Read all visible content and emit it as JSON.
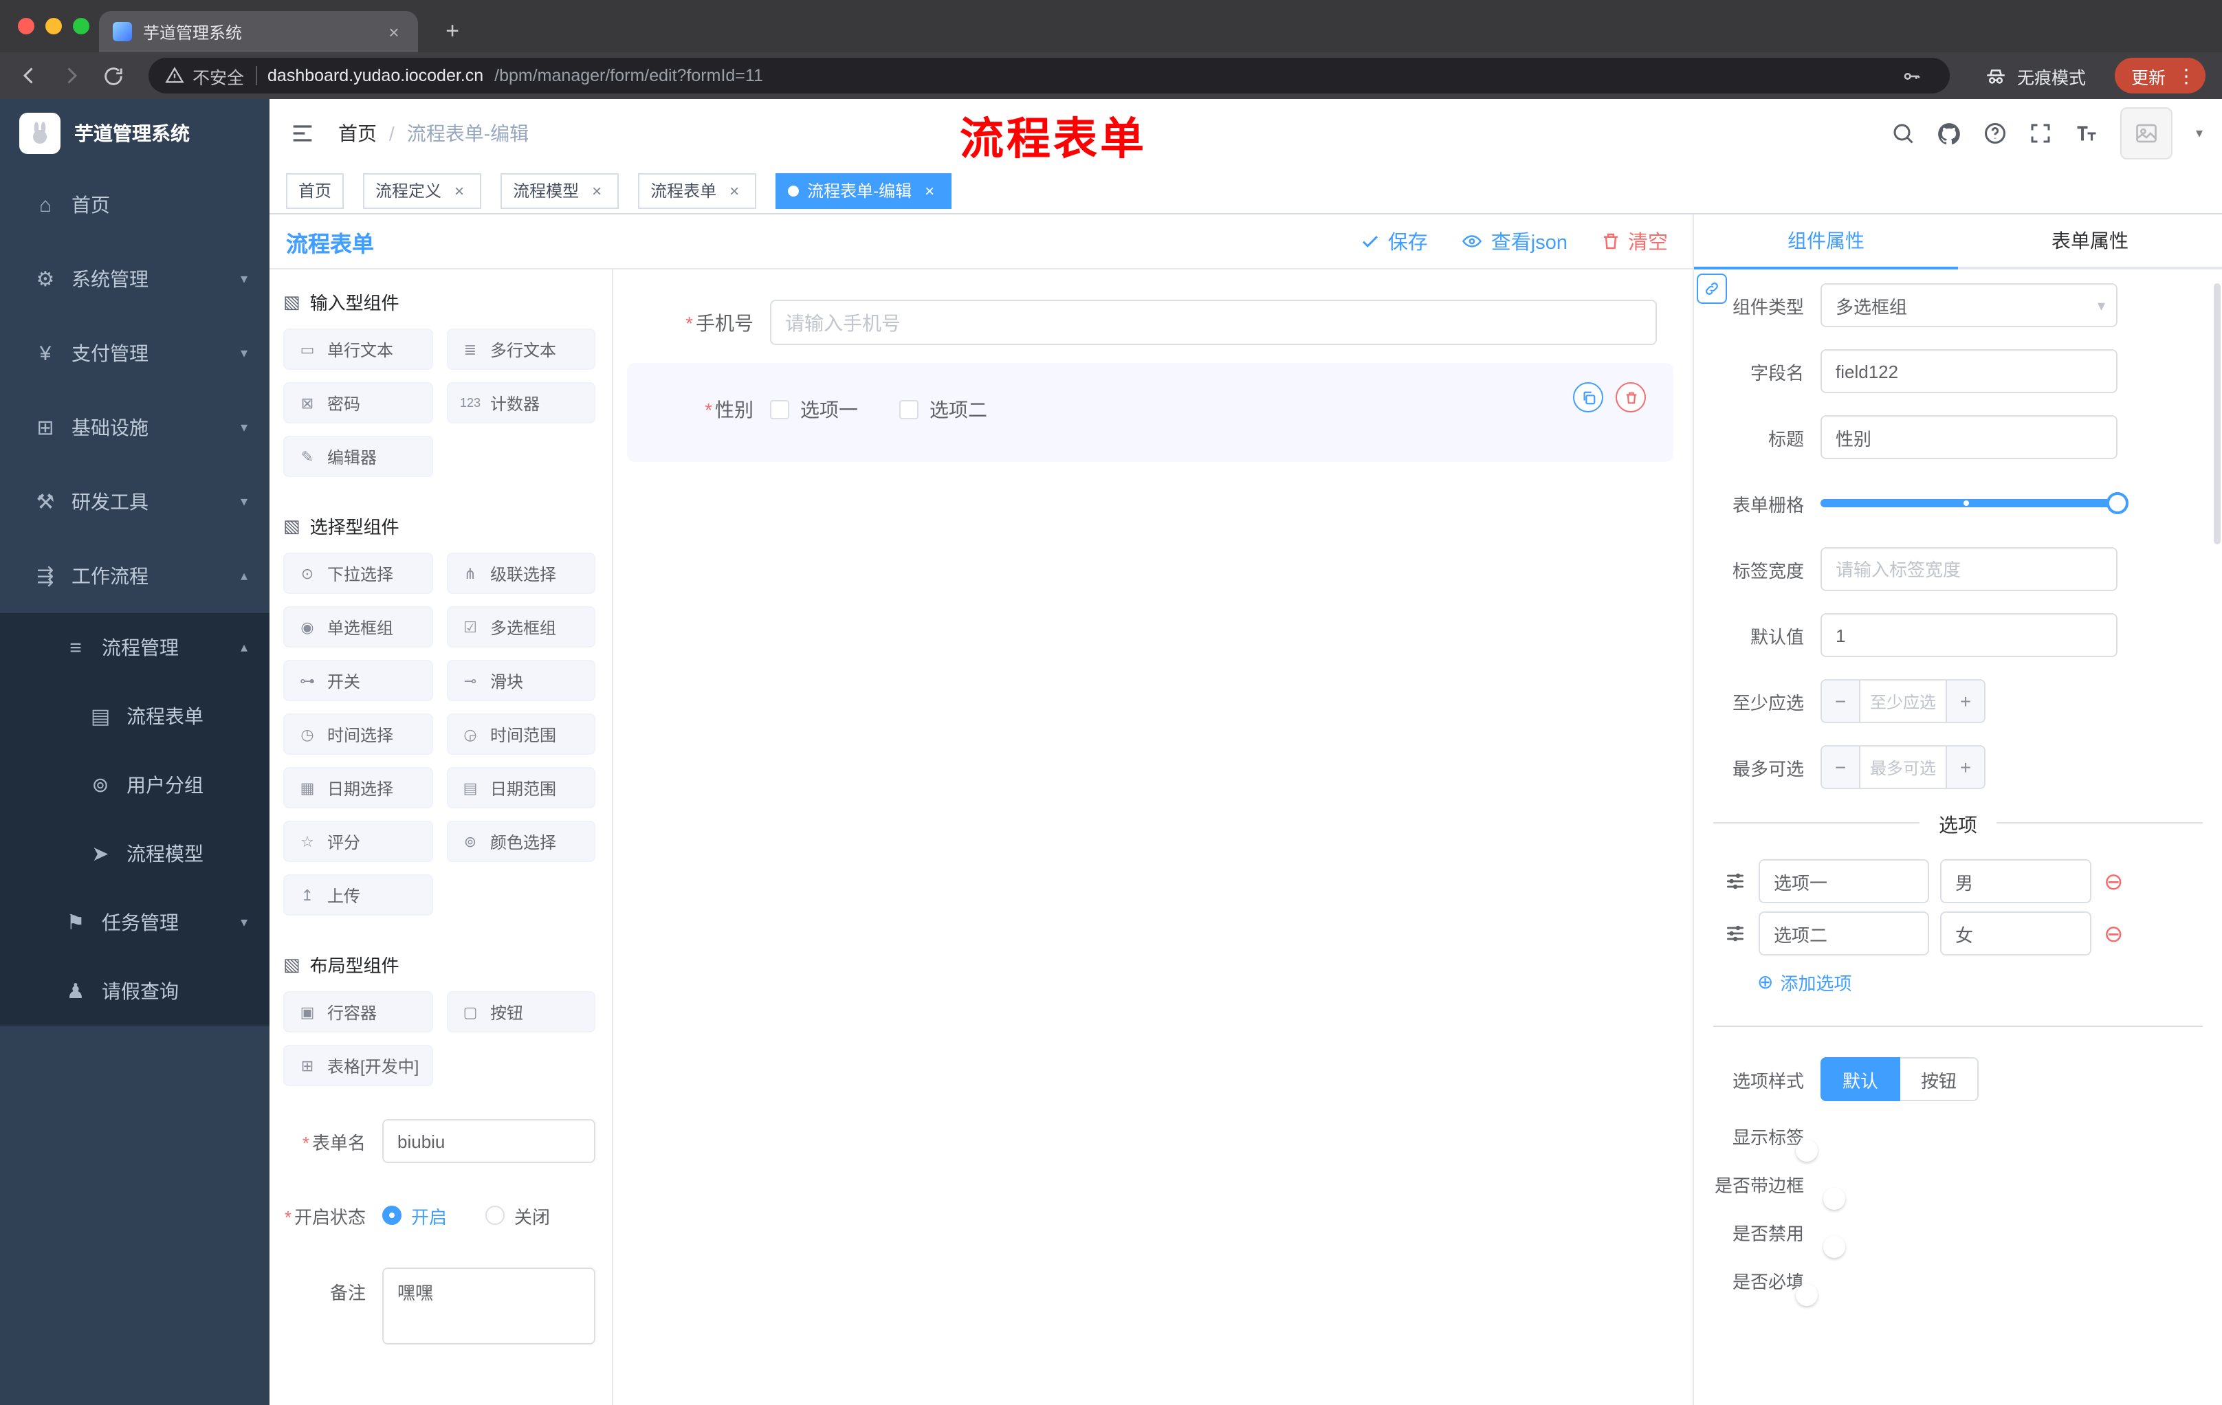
{
  "colors": {
    "accent": "#409eff",
    "danger": "#f56c6c",
    "annotation": "#ff0000",
    "sidebar_bg": "#304156",
    "sidebar_sub_bg": "#1f2d3d"
  },
  "icons": {
    "close": "×",
    "plus": "+",
    "kebab": "⋮",
    "caret_down": "▾",
    "required": "*",
    "minus": "−",
    "plus_sign": "+",
    "circle_plus": "⊕",
    "circle_minus": "⊖",
    "group": "▧"
  },
  "browser": {
    "tab_title": "芋道管理系统",
    "security_label": "不安全",
    "url_host": "dashboard.yudao.iocoder.cn",
    "url_path": "/bpm/manager/form/edit?formId=11",
    "incognito_label": "无痕模式",
    "update_label": "更新"
  },
  "annotation": {
    "text": "流程表单"
  },
  "sidebar": {
    "logo_title": "芋道管理系统",
    "items": [
      {
        "icon": "⌂",
        "label": "首页",
        "level": 1,
        "chevron": ""
      },
      {
        "icon": "⚙",
        "label": "系统管理",
        "level": 1,
        "chevron": "▾"
      },
      {
        "icon": "¥",
        "label": "支付管理",
        "level": 1,
        "chevron": "▾"
      },
      {
        "icon": "⊞",
        "label": "基础设施",
        "level": 1,
        "chevron": "▾"
      },
      {
        "icon": "⚒",
        "label": "研发工具",
        "level": 1,
        "chevron": "▾"
      },
      {
        "icon": "⇶",
        "label": "工作流程",
        "level": 1,
        "chevron": "▴"
      },
      {
        "icon": "≡",
        "label": "流程管理",
        "level": 2,
        "chevron": "▴"
      },
      {
        "icon": "▤",
        "label": "流程表单",
        "level": 3,
        "chevron": ""
      },
      {
        "icon": "⊚",
        "label": "用户分组",
        "level": 3,
        "chevron": ""
      },
      {
        "icon": "➤",
        "label": "流程模型",
        "level": 3,
        "chevron": ""
      },
      {
        "icon": "⚑",
        "label": "任务管理",
        "level": 2,
        "chevron": "▾"
      },
      {
        "icon": "♟",
        "label": "请假查询",
        "level": 2,
        "chevron": ""
      }
    ]
  },
  "header": {
    "breadcrumb_home": "首页",
    "breadcrumb_separator": "/",
    "breadcrumb_current": "流程表单-编辑"
  },
  "tags": [
    {
      "label": "首页",
      "active": false,
      "closable": false
    },
    {
      "label": "流程定义",
      "active": false,
      "closable": true
    },
    {
      "label": "流程模型",
      "active": false,
      "closable": true
    },
    {
      "label": "流程表单",
      "active": false,
      "closable": true
    },
    {
      "label": "流程表单-编辑",
      "active": true,
      "closable": true
    }
  ],
  "designer": {
    "title": "流程表单",
    "actions": {
      "save": "保存",
      "view_json": "查看json",
      "clear": "清空"
    },
    "groups": [
      {
        "title": "输入型组件",
        "items": [
          {
            "icon": "▭",
            "label": "单行文本"
          },
          {
            "icon": "≣",
            "label": "多行文本"
          },
          {
            "icon": "⊠",
            "label": "密码"
          },
          {
            "icon": "123",
            "label": "计数器"
          },
          {
            "icon": "✎",
            "label": "编辑器"
          }
        ]
      },
      {
        "title": "选择型组件",
        "items": [
          {
            "icon": "⊙",
            "label": "下拉选择"
          },
          {
            "icon": "⋔",
            "label": "级联选择"
          },
          {
            "icon": "◉",
            "label": "单选框组"
          },
          {
            "icon": "☑",
            "label": "多选框组"
          },
          {
            "icon": "⊶",
            "label": "开关"
          },
          {
            "icon": "⊸",
            "label": "滑块"
          },
          {
            "icon": "◷",
            "label": "时间选择"
          },
          {
            "icon": "◶",
            "label": "时间范围"
          },
          {
            "icon": "▦",
            "label": "日期选择"
          },
          {
            "icon": "▤",
            "label": "日期范围"
          },
          {
            "icon": "☆",
            "label": "评分"
          },
          {
            "icon": "⊚",
            "label": "颜色选择"
          },
          {
            "icon": "↥",
            "label": "上传"
          }
        ]
      },
      {
        "title": "布局型组件",
        "items": [
          {
            "icon": "▣",
            "label": "行容器"
          },
          {
            "icon": "▢",
            "label": "按钮"
          },
          {
            "icon": "⊞",
            "label": "表格[开发中]"
          }
        ]
      }
    ],
    "form": {
      "name_label": "表单名",
      "name_value": "biubiu",
      "status_label": "开启状态",
      "status_on": "开启",
      "status_off": "关闭",
      "status_selected": "开启",
      "remark_label": "备注",
      "remark_value": "嘿嘿"
    },
    "canvas": {
      "phone_label": "手机号",
      "phone_placeholder": "请输入手机号",
      "gender_label": "性别",
      "gender_options": [
        "选项一",
        "选项二"
      ]
    }
  },
  "properties": {
    "tab_component": "组件属性",
    "tab_form": "表单属性",
    "active_tab": "组件属性",
    "rows": {
      "type_label": "组件类型",
      "type_value": "多选框组",
      "field_label": "字段名",
      "field_value": "field122",
      "title_label": "标题",
      "title_value": "性别",
      "grid_label": "表单栅格",
      "width_label": "标签宽度",
      "width_placeholder": "请输入标签宽度",
      "default_label": "默认值",
      "default_value": "1",
      "min_label": "至少应选",
      "min_placeholder": "至少应选",
      "max_label": "最多可选",
      "max_placeholder": "最多可选"
    },
    "options": {
      "divider": "选项",
      "rows": [
        {
          "label": "选项一",
          "value": "男"
        },
        {
          "label": "选项二",
          "value": "女"
        }
      ],
      "add": "添加选项"
    },
    "style": {
      "option_style_label": "选项样式",
      "option_default": "默认",
      "option_button": "按钮",
      "option_selected": "默认",
      "show_label": "显示标签",
      "show_label_on": true,
      "border_label": "是否带边框",
      "border_on": false,
      "disabled_label": "是否禁用",
      "disabled_on": false,
      "required_label": "是否必填",
      "required_on": true
    }
  }
}
